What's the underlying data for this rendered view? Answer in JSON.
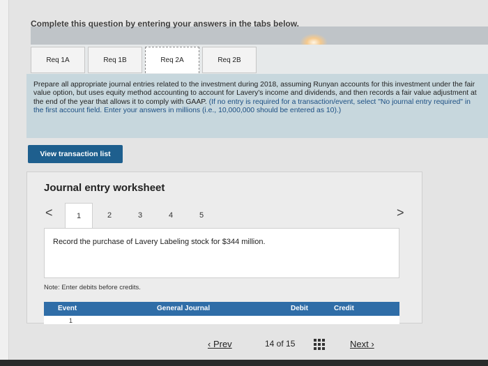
{
  "banner": "Complete this question by entering your answers in the tabs below.",
  "tabs": [
    {
      "label": "Req 1A"
    },
    {
      "label": "Req 1B"
    },
    {
      "label": "Req 2A",
      "active": true
    },
    {
      "label": "Req 2B"
    }
  ],
  "instructions": {
    "main": "Prepare all appropriate journal entries related to the investment during 2018, assuming Runyan accounts for this investment under the fair value option, but uses equity method accounting to account for Lavery's income and dividends, and then records a fair value adjustment at the end of the year that allows it to comply with GAAP.",
    "note": "(If no entry is required for a transaction/event, select \"No journal entry required\" in the first account field. Enter your answers in millions (i.e., 10,000,000 should be entered as 10).)"
  },
  "view_button": "View transaction list",
  "worksheet": {
    "title": "Journal entry worksheet",
    "prev_arrow": "<",
    "next_arrow": ">",
    "numbers": [
      "1",
      "2",
      "3",
      "4",
      "5"
    ],
    "active_number": "1",
    "description": "Record the purchase of Lavery Labeling stock for $344 million.",
    "note": "Note: Enter debits before credits.",
    "columns": [
      "Event",
      "General Journal",
      "Debit",
      "Credit"
    ],
    "row_event": "1"
  },
  "footer": {
    "prev": "Prev",
    "page": "14 of 15",
    "next": "Next"
  },
  "colors": {
    "accent": "#1e5f8e",
    "table_header": "#2f6da7",
    "instructions_bg": "#c7d7dd"
  }
}
